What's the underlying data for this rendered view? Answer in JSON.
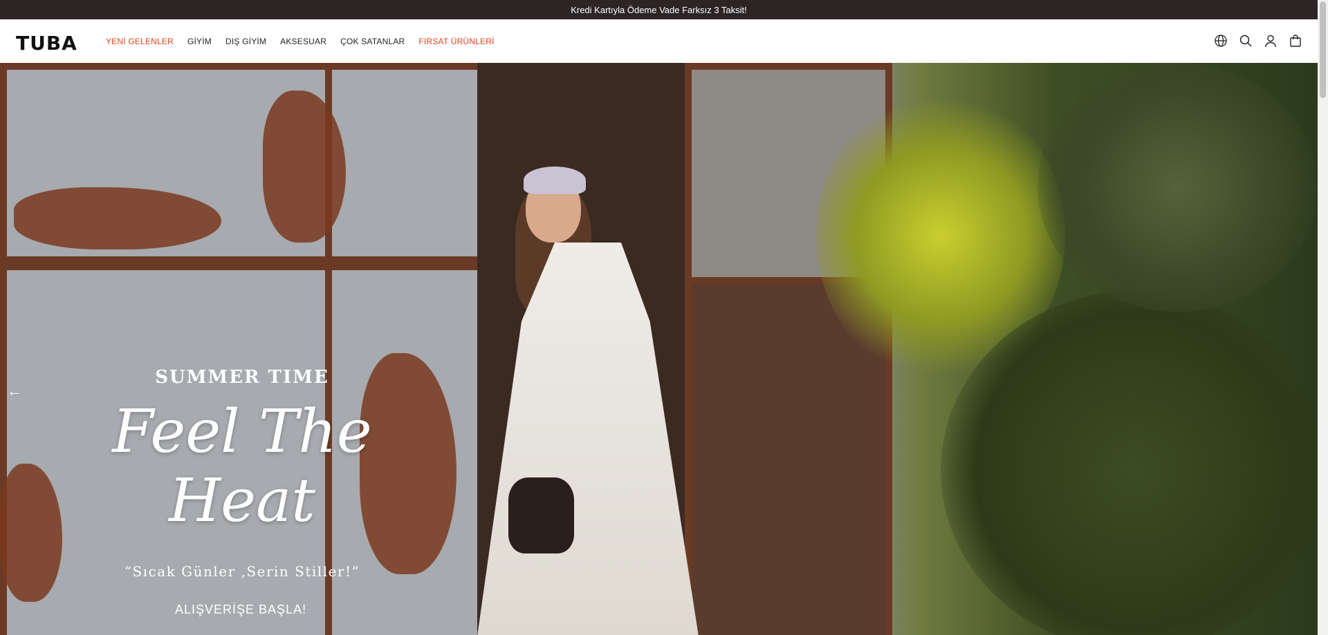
{
  "announcement": "Kredi Kartıyla Ödeme Vade Farksız 3 Taksit!",
  "header": {
    "logo": "TUBA",
    "nav": [
      {
        "label": "YENİ GELENLER",
        "color": "#e0401c"
      },
      {
        "label": "GİYİM"
      },
      {
        "label": "DIŞ GİYİM"
      },
      {
        "label": "AKSESUAR"
      },
      {
        "label": "ÇOK SATANLAR"
      },
      {
        "label": "FIRSAT ÜRÜNLERİ",
        "color": "#e0401c"
      }
    ],
    "icons": [
      "globe-icon",
      "search-icon",
      "user-icon",
      "bag-icon"
    ]
  },
  "hero": {
    "eyebrow": "SUMMER TIME",
    "headline": "Feel The Heat",
    "subline": "“Sıcak Günler ,Serin Stiller!”",
    "cta": "ALIŞVERİŞE BAŞLA!",
    "prev_arrow": "←"
  },
  "colors": {
    "announcement_bg": "#2c2526",
    "accent": "#e0401c"
  }
}
